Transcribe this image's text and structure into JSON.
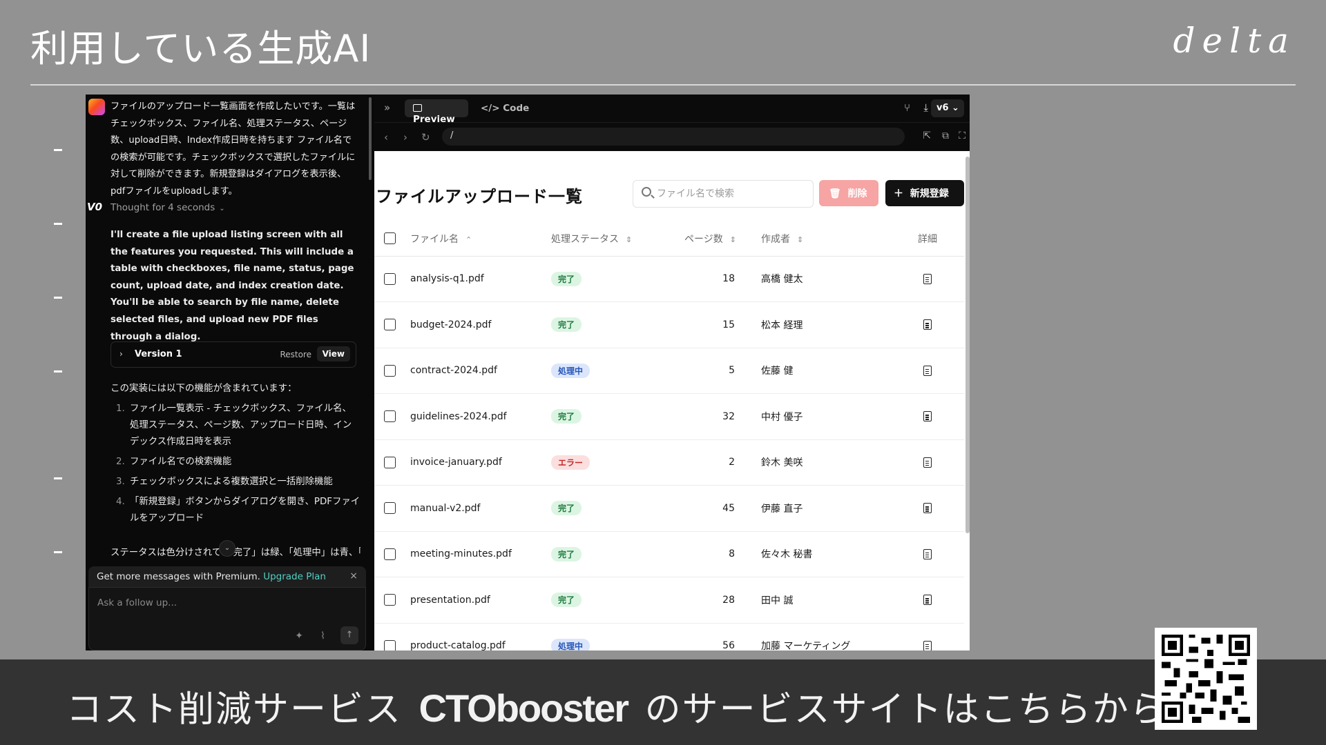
{
  "slide": {
    "title": "利用している生成AI",
    "brand": "delta"
  },
  "chat": {
    "prompt": "ファイルのアップロード一覧画面を作成したいです。一覧はチェックボックス、ファイル名、処理ステータス、ページ数、upload日時、Index作成日時を持ちます ファイル名での検索が可能です。チェックボックスで選択したファイルに対して削除ができます。新規登録はダイアログを表示後、pdfファイルをuploadします。",
    "thought": "Thought for 4 seconds",
    "reply": "I'll create a file upload listing screen with all the features you requested. This will include a table with checkboxes, file name, status, page count, upload date, and index creation date. You'll be able to search by file name, delete selected files, and upload new PDF files through a dialog.",
    "version_label": "Version 1",
    "restore_label": "Restore",
    "view_label": "View",
    "intro": "この実装には以下の機能が含まれています：",
    "features": [
      "ファイル一覧表示 - チェックボックス、ファイル名、処理ステータス、ページ数、アップロード日時、インデックス作成日時を表示",
      "ファイル名での検索機能",
      "チェックボックスによる複数選択と一括削除機能",
      "「新規登録」ボタンからダイアログを開き、PDFファイルをアップロード"
    ],
    "status_note": "ステータスは色分けされてお 完了」は緑、「処理中」は青、「エ",
    "premium_text": "Get more messages with Premium.",
    "upgrade_label": "Upgrade Plan",
    "followup_placeholder": "Ask a follow up..."
  },
  "preview": {
    "tab_preview": "Preview",
    "tab_code": "Code",
    "version": "v6",
    "url": "/",
    "page_title": "ファイルアップロード一覧",
    "search_placeholder": "ファイル名で検索",
    "delete_label": "削除",
    "new_label": "新規登録",
    "columns": [
      "ファイル名",
      "処理ステータス",
      "ページ数",
      "作成者",
      "詳細"
    ],
    "rows": [
      {
        "file": "analysis-q1.pdf",
        "status": "完了",
        "pages": "18",
        "author": "高橋 健太"
      },
      {
        "file": "budget-2024.pdf",
        "status": "完了",
        "pages": "15",
        "author": "松本 経理"
      },
      {
        "file": "contract-2024.pdf",
        "status": "処理中",
        "pages": "5",
        "author": "佐藤 健"
      },
      {
        "file": "guidelines-2024.pdf",
        "status": "完了",
        "pages": "32",
        "author": "中村 優子"
      },
      {
        "file": "invoice-january.pdf",
        "status": "エラー",
        "pages": "2",
        "author": "鈴木 美咲"
      },
      {
        "file": "manual-v2.pdf",
        "status": "完了",
        "pages": "45",
        "author": "伊藤 直子"
      },
      {
        "file": "meeting-minutes.pdf",
        "status": "完了",
        "pages": "8",
        "author": "佐々木 秘書"
      },
      {
        "file": "presentation.pdf",
        "status": "完了",
        "pages": "28",
        "author": "田中 誠"
      },
      {
        "file": "product-catalog.pdf",
        "status": "処理中",
        "pages": "56",
        "author": "加藤 マーケティング"
      }
    ]
  },
  "footer": {
    "cta_prefix": "コスト削減サービス",
    "cta_brand": "CTObooster",
    "cta_suffix": "のサービスサイトはこちらから▶"
  }
}
